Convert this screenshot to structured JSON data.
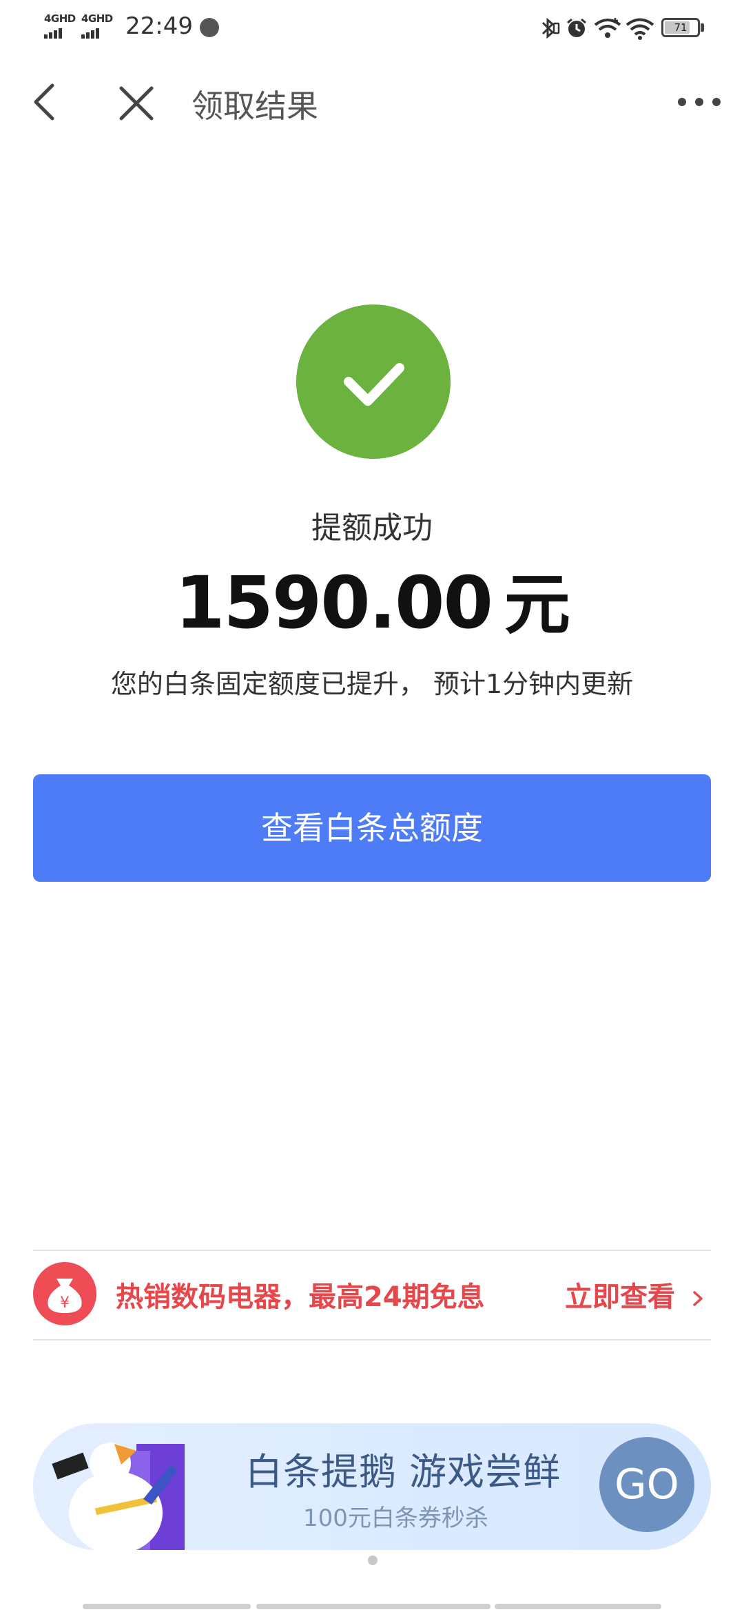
{
  "status_bar": {
    "network1": "4GHD",
    "network2": "4GHD",
    "time": "22:49",
    "battery": "71"
  },
  "nav": {
    "title": "领取结果"
  },
  "result": {
    "label": "提额成功",
    "amount": "1590.00",
    "unit": "元",
    "description": "您的白条固定额度已提升， 预计1分钟内更新"
  },
  "primary_button": {
    "label": "查看白条总额度"
  },
  "promo": {
    "text": "热销数码电器，最高24期免息",
    "link": "立即查看"
  },
  "banner": {
    "title": "白条提鹅 游戏尝鲜",
    "subtitle": "100元白条券秒杀",
    "go": "GO"
  },
  "colors": {
    "success_green": "#6bb33e",
    "primary_blue": "#4e7cf7",
    "promo_red": "#e5474b"
  }
}
